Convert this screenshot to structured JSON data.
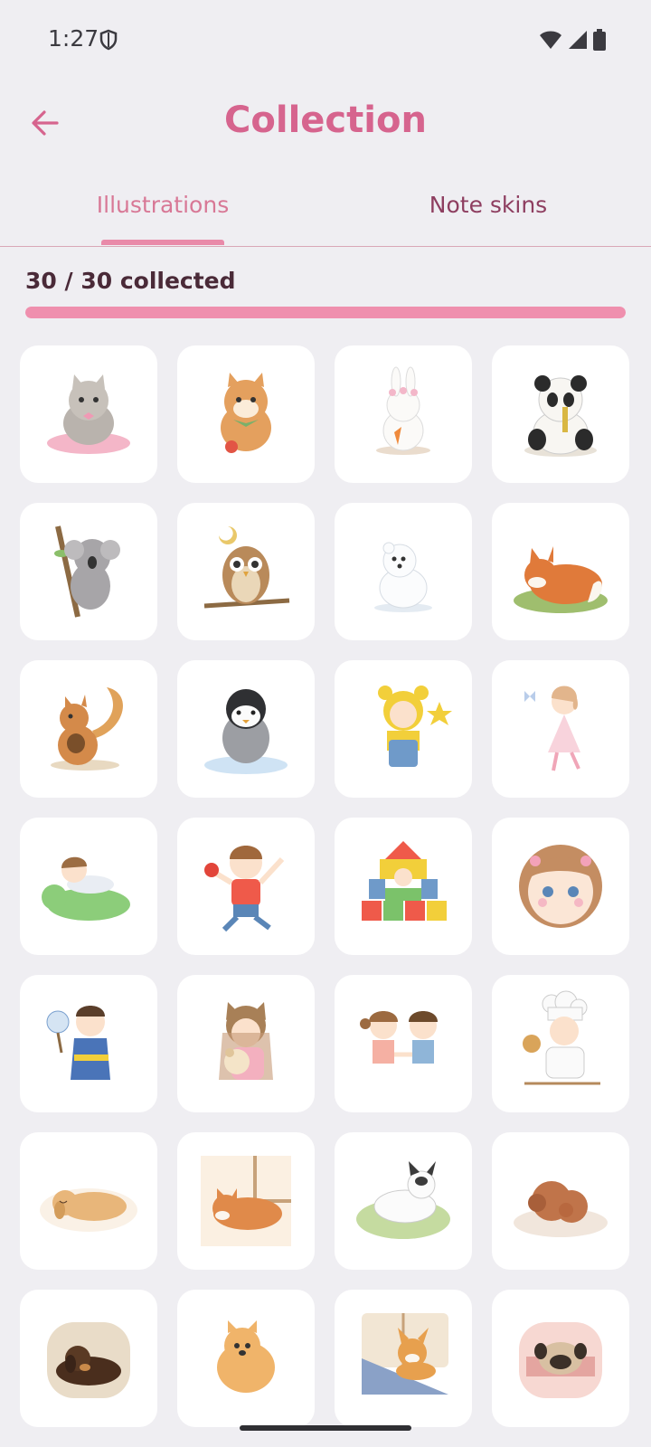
{
  "status": {
    "time": "1:27"
  },
  "header": {
    "title": "Collection"
  },
  "tabs": [
    {
      "label": "Illustrations",
      "selected": true
    },
    {
      "label": "Note skins",
      "selected": false
    }
  ],
  "progress": {
    "label": "30 / 30 collected",
    "fraction": 1.0
  },
  "colors": {
    "accent": "#d6648e",
    "progress": "#ef8fae",
    "background": "#efeef2"
  },
  "illustrations": [
    {
      "name": "cat-on-cushion-illustration",
      "icon": "cat"
    },
    {
      "name": "shiba-with-apple-illustration",
      "icon": "shiba"
    },
    {
      "name": "bunny-with-carrot-illustration",
      "icon": "bunny"
    },
    {
      "name": "panda-eating-bamboo-illustration",
      "icon": "panda"
    },
    {
      "name": "koala-on-branch-illustration",
      "icon": "koala"
    },
    {
      "name": "owl-on-branch-illustration",
      "icon": "owl"
    },
    {
      "name": "polar-bear-illustration",
      "icon": "polar-bear"
    },
    {
      "name": "sleeping-fox-illustration",
      "icon": "fox"
    },
    {
      "name": "squirrel-with-acorn-illustration",
      "icon": "squirrel"
    },
    {
      "name": "penguin-on-ice-illustration",
      "icon": "penguin"
    },
    {
      "name": "child-in-bear-hood-illustration",
      "icon": "child-bear-hood"
    },
    {
      "name": "dancing-girl-illustration",
      "icon": "dancing-girl"
    },
    {
      "name": "baby-on-dinosaur-illustration",
      "icon": "baby-dinosaur"
    },
    {
      "name": "boy-with-apple-illustration",
      "icon": "boy-apple"
    },
    {
      "name": "child-in-blocks-illustration",
      "icon": "blocks"
    },
    {
      "name": "girl-face-illustration",
      "icon": "girl-face"
    },
    {
      "name": "boy-in-yukata-illustration",
      "icon": "yukata-boy"
    },
    {
      "name": "girl-hugging-puppy-illustration",
      "icon": "girl-puppy"
    },
    {
      "name": "two-kids-holding-hands-illustration",
      "icon": "two-kids"
    },
    {
      "name": "child-chef-illustration",
      "icon": "chef"
    },
    {
      "name": "sleeping-golden-dog-illustration",
      "icon": "sleeping-dog"
    },
    {
      "name": "sleeping-shiba-illustration",
      "icon": "sleeping-shiba"
    },
    {
      "name": "frenchie-on-grass-illustration",
      "icon": "frenchie"
    },
    {
      "name": "sleeping-poodle-illustration",
      "icon": "poodle"
    },
    {
      "name": "sleeping-dachshund-illustration",
      "icon": "dachshund"
    },
    {
      "name": "pomeranian-illustration",
      "icon": "pomeranian"
    },
    {
      "name": "corgi-at-window-illustration",
      "icon": "corgi"
    },
    {
      "name": "pug-under-blanket-illustration",
      "icon": "pug"
    }
  ]
}
